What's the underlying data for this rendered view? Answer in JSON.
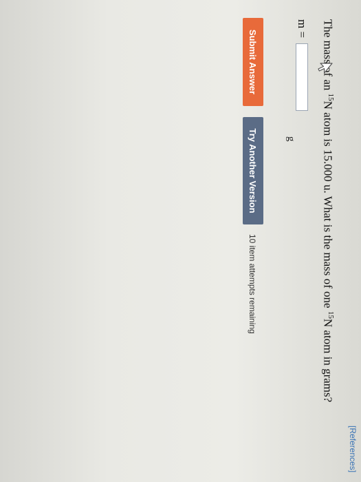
{
  "header": {
    "references_label": "[References]"
  },
  "question": {
    "part1": "The mass of an ",
    "iso1_mass": "15",
    "iso1_symbol": "N",
    "part2": " atom is 15.000 u. What is the mass of one ",
    "iso2_mass": "15",
    "iso2_symbol": "N",
    "part3": " atom in grams?"
  },
  "answer": {
    "label": "m =",
    "value": "",
    "unit": "g"
  },
  "actions": {
    "submit_label": "Submit Answer",
    "try_label": "Try Another Version"
  },
  "status": {
    "attempts_text": "10 item attempts remaining"
  },
  "colors": {
    "submit": "#e86a3a",
    "try": "#5b6c86",
    "link": "#3a73b5"
  }
}
